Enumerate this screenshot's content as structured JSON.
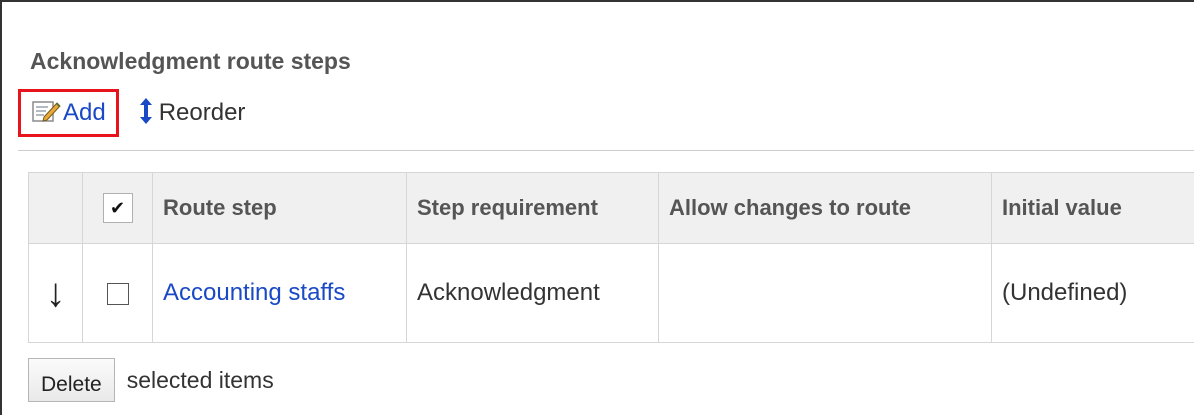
{
  "section": {
    "title": "Acknowledgment route steps"
  },
  "toolbar": {
    "add_label": "Add",
    "add_icon": "edit-note-icon",
    "reorder_label": "Reorder",
    "reorder_icon": "up-down-arrow-icon"
  },
  "table": {
    "select_all_mark": "✔",
    "headers": [
      "Route step",
      "Step requirement",
      "Allow changes to route",
      "Initial value"
    ],
    "rows": [
      {
        "order_arrow": "↓",
        "route_step": "Accounting staffs",
        "step_requirement": "Acknowledgment",
        "allow_changes": "",
        "initial_value": "(Undefined)"
      }
    ]
  },
  "footer": {
    "delete_label": "Delete",
    "selected_items_label": "selected items"
  },
  "colors": {
    "link": "#1a49c6",
    "highlight_border": "#e8141c",
    "header_bg": "#f0f0f0"
  }
}
